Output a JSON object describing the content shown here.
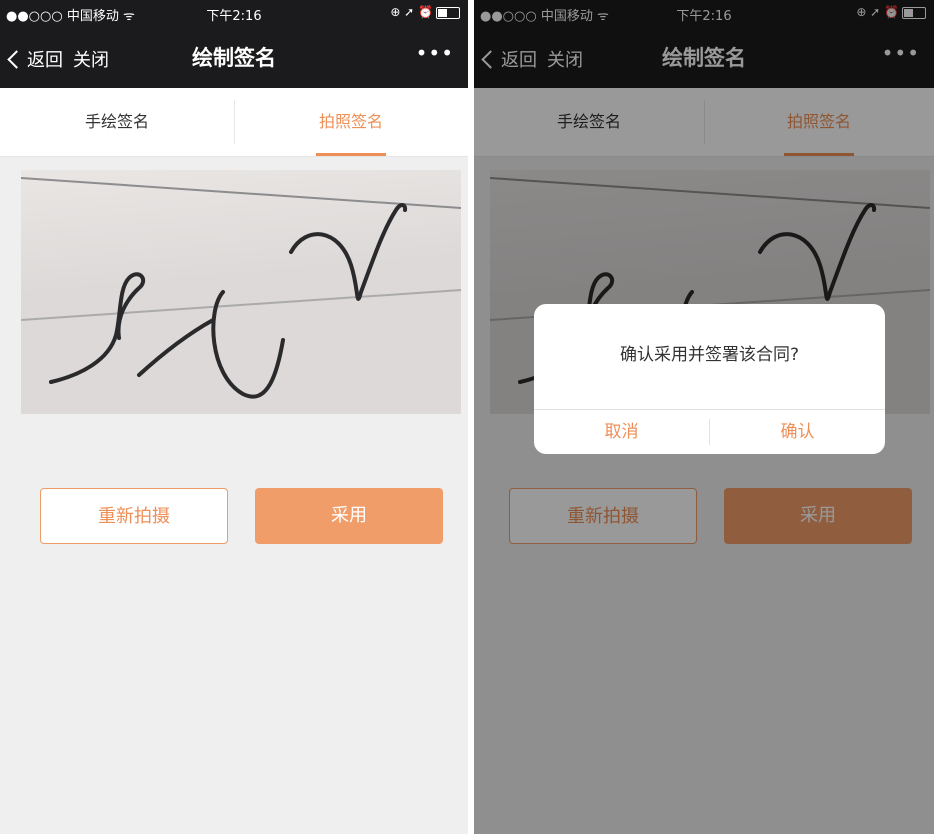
{
  "status_bar": {
    "carrier": "●●○○○ 中国移动 ᯤ",
    "time": "下午2:16",
    "icons": "⊕ ➚ ⏰"
  },
  "nav": {
    "back_label": "返回",
    "close_label": "关闭",
    "title": "绘制签名",
    "more_label": "•••"
  },
  "tabs": [
    {
      "label": "手绘签名",
      "active": false
    },
    {
      "label": "拍照签名",
      "active": true
    }
  ],
  "buttons": {
    "retake_label": "重新拍摄",
    "use_label": "采用"
  },
  "dialog": {
    "message": "确认采用并签署该合同?",
    "cancel_label": "取消",
    "confirm_label": "确认"
  },
  "colors": {
    "accent": "#ee8f57",
    "nav_background": "#1b1b1d",
    "page_background": "#f0efef"
  }
}
